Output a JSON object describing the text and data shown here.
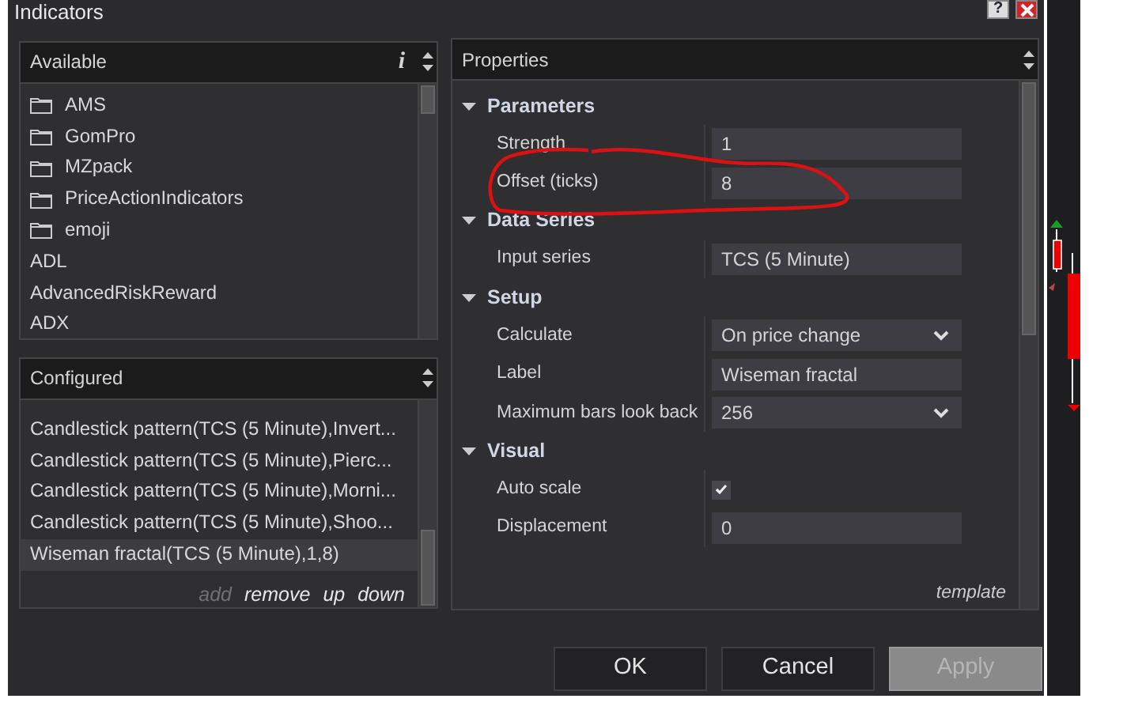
{
  "window": {
    "title": "Indicators",
    "help_label": "?"
  },
  "available": {
    "title": "Available",
    "info_label": "i",
    "items": [
      {
        "kind": "folder",
        "label": "AMS"
      },
      {
        "kind": "folder",
        "label": "GomPro"
      },
      {
        "kind": "folder",
        "label": "MZpack"
      },
      {
        "kind": "folder",
        "label": "PriceActionIndicators"
      },
      {
        "kind": "folder",
        "label": "emoji"
      },
      {
        "kind": "item",
        "label": "ADL"
      },
      {
        "kind": "item",
        "label": "AdvancedRiskReward"
      },
      {
        "kind": "item",
        "label": "ADX"
      }
    ]
  },
  "configured": {
    "title": "Configured",
    "items": [
      {
        "label": "Candlestick pattern(TCS (5 Minute),Invert...",
        "selected": false
      },
      {
        "label": "Candlestick pattern(TCS (5 Minute),Pierc...",
        "selected": false
      },
      {
        "label": "Candlestick pattern(TCS (5 Minute),Morni...",
        "selected": false
      },
      {
        "label": "Candlestick pattern(TCS (5 Minute),Shoo...",
        "selected": false
      },
      {
        "label": "Wiseman fractal(TCS (5 Minute),1,8)",
        "selected": true
      }
    ],
    "actions": [
      {
        "label": "add",
        "disabled": true
      },
      {
        "label": "remove",
        "disabled": false
      },
      {
        "label": "up",
        "disabled": false
      },
      {
        "label": "down",
        "disabled": false
      }
    ]
  },
  "properties": {
    "title": "Properties",
    "template_label": "template",
    "groups": [
      {
        "label": "Parameters",
        "expanded": true,
        "rows": [
          {
            "kind": "text",
            "label": "Strength",
            "value": "1"
          },
          {
            "kind": "text",
            "label": "Offset (ticks)",
            "value": "8"
          }
        ]
      },
      {
        "label": "Data Series",
        "expanded": true,
        "rows": [
          {
            "kind": "text",
            "label": "Input series",
            "value": "TCS (5 Minute)"
          }
        ]
      },
      {
        "label": "Setup",
        "expanded": true,
        "rows": [
          {
            "kind": "select",
            "label": "Calculate",
            "value": "On price change"
          },
          {
            "kind": "text",
            "label": "Label",
            "value": "Wiseman fractal"
          },
          {
            "kind": "select",
            "label": "Maximum bars look back",
            "value": "256"
          }
        ]
      },
      {
        "label": "Visual",
        "expanded": true,
        "rows": [
          {
            "kind": "check",
            "label": "Auto scale",
            "checked": true
          },
          {
            "kind": "text",
            "label": "Displacement",
            "value": "0"
          }
        ]
      }
    ]
  },
  "buttons": [
    {
      "label": "OK",
      "disabled": false
    },
    {
      "label": "Cancel",
      "disabled": false
    },
    {
      "label": "Apply",
      "disabled": true
    }
  ]
}
